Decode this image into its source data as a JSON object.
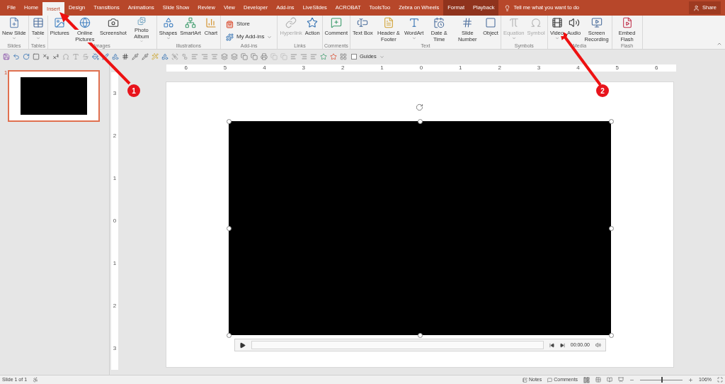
{
  "tabs": [
    {
      "label": "File",
      "selected": false,
      "contextual": false
    },
    {
      "label": "Home",
      "selected": false,
      "contextual": false
    },
    {
      "label": "Insert",
      "selected": true,
      "contextual": false
    },
    {
      "label": "Design",
      "selected": false,
      "contextual": false
    },
    {
      "label": "Transitions",
      "selected": false,
      "contextual": false
    },
    {
      "label": "Animations",
      "selected": false,
      "contextual": false
    },
    {
      "label": "Slide Show",
      "selected": false,
      "contextual": false
    },
    {
      "label": "Review",
      "selected": false,
      "contextual": false
    },
    {
      "label": "View",
      "selected": false,
      "contextual": false
    },
    {
      "label": "Developer",
      "selected": false,
      "contextual": false
    },
    {
      "label": "Add-ins",
      "selected": false,
      "contextual": false
    },
    {
      "label": "LiveSlides",
      "selected": false,
      "contextual": false
    },
    {
      "label": "ACROBAT",
      "selected": false,
      "contextual": false
    },
    {
      "label": "ToolsToo",
      "selected": false,
      "contextual": false
    },
    {
      "label": "Zebra on Wheels",
      "selected": false,
      "contextual": false
    },
    {
      "label": "Format",
      "selected": false,
      "contextual": true
    },
    {
      "label": "Playback",
      "selected": false,
      "contextual": true
    }
  ],
  "tell_me": "Tell me what you want to do",
  "share": "Share",
  "ribbon_groups": [
    {
      "name": "Slides",
      "buttons": [
        {
          "kind": "large",
          "label": "New Slide",
          "caret": true,
          "disabled": false
        }
      ]
    },
    {
      "name": "Tables",
      "buttons": [
        {
          "kind": "large",
          "label": "Table",
          "caret": true,
          "disabled": false
        }
      ]
    },
    {
      "name": "Images",
      "buttons": [
        {
          "kind": "large",
          "label": "Pictures",
          "caret": false,
          "disabled": false
        },
        {
          "kind": "large",
          "label": "Online Pictures",
          "caret": false,
          "disabled": false
        },
        {
          "kind": "large",
          "label": "Screenshot",
          "caret": false,
          "disabled": false
        },
        {
          "kind": "large",
          "label": "Photo Album",
          "caret": true,
          "disabled": false
        }
      ]
    },
    {
      "name": "Illustrations",
      "buttons": [
        {
          "kind": "large",
          "label": "Shapes",
          "caret": true,
          "disabled": false
        },
        {
          "kind": "large",
          "label": "SmartArt",
          "caret": false,
          "disabled": false
        },
        {
          "kind": "large",
          "label": "Chart",
          "caret": false,
          "disabled": false
        }
      ]
    },
    {
      "name": "Add-ins",
      "buttons": [
        {
          "kind": "small",
          "label": "Store",
          "caret": false,
          "disabled": false
        },
        {
          "kind": "small",
          "label": "My Add-ins",
          "caret": true,
          "disabled": false
        }
      ]
    },
    {
      "name": "Links",
      "buttons": [
        {
          "kind": "large",
          "label": "Hyperlink",
          "caret": false,
          "disabled": true
        },
        {
          "kind": "large",
          "label": "Action",
          "caret": false,
          "disabled": false
        }
      ]
    },
    {
      "name": "Comments",
      "buttons": [
        {
          "kind": "large",
          "label": "Comment",
          "caret": false,
          "disabled": false
        }
      ]
    },
    {
      "name": "Text",
      "buttons": [
        {
          "kind": "large",
          "label": "Text Box",
          "caret": false,
          "disabled": false
        },
        {
          "kind": "large",
          "label": "Header & Footer",
          "caret": false,
          "disabled": false
        },
        {
          "kind": "large",
          "label": "WordArt",
          "caret": true,
          "disabled": false
        },
        {
          "kind": "large",
          "label": "Date & Time",
          "caret": false,
          "disabled": false
        },
        {
          "kind": "large",
          "label": "Slide Number",
          "caret": false,
          "disabled": false
        },
        {
          "kind": "large",
          "label": "Object",
          "caret": false,
          "disabled": false
        }
      ]
    },
    {
      "name": "Symbols",
      "buttons": [
        {
          "kind": "large",
          "label": "Equation",
          "caret": true,
          "disabled": true
        },
        {
          "kind": "large",
          "label": "Symbol",
          "caret": false,
          "disabled": true
        }
      ]
    },
    {
      "name": "Media",
      "buttons": [
        {
          "kind": "large",
          "label": "Video",
          "caret": true,
          "disabled": false
        },
        {
          "kind": "large",
          "label": "Audio",
          "caret": false,
          "disabled": false
        },
        {
          "kind": "large",
          "label": "Screen Recording",
          "caret": false,
          "disabled": false
        }
      ]
    },
    {
      "name": "Flash",
      "buttons": [
        {
          "kind": "large",
          "label": "Embed Flash",
          "caret": false,
          "disabled": false
        }
      ]
    }
  ],
  "guides": {
    "label": "Guides",
    "checked": false
  },
  "ruler": {
    "horizontal": [
      "6",
      "5",
      "4",
      "3",
      "2",
      "1",
      "0",
      "1",
      "2",
      "3",
      "4",
      "5",
      "6"
    ],
    "vertical": [
      "3",
      "2",
      "1",
      "0",
      "1",
      "2",
      "3"
    ]
  },
  "thumbnails": [
    {
      "number": "1",
      "selected": true
    }
  ],
  "player": {
    "time": "00:00.00"
  },
  "callouts": [
    {
      "number": "1"
    },
    {
      "number": "2"
    }
  ],
  "status_bar": {
    "slide": "Slide 1 of 1",
    "notes": "Notes",
    "comments": "Comments",
    "zoom": "106%",
    "zoom_slider": {
      "level": 0.5
    }
  }
}
